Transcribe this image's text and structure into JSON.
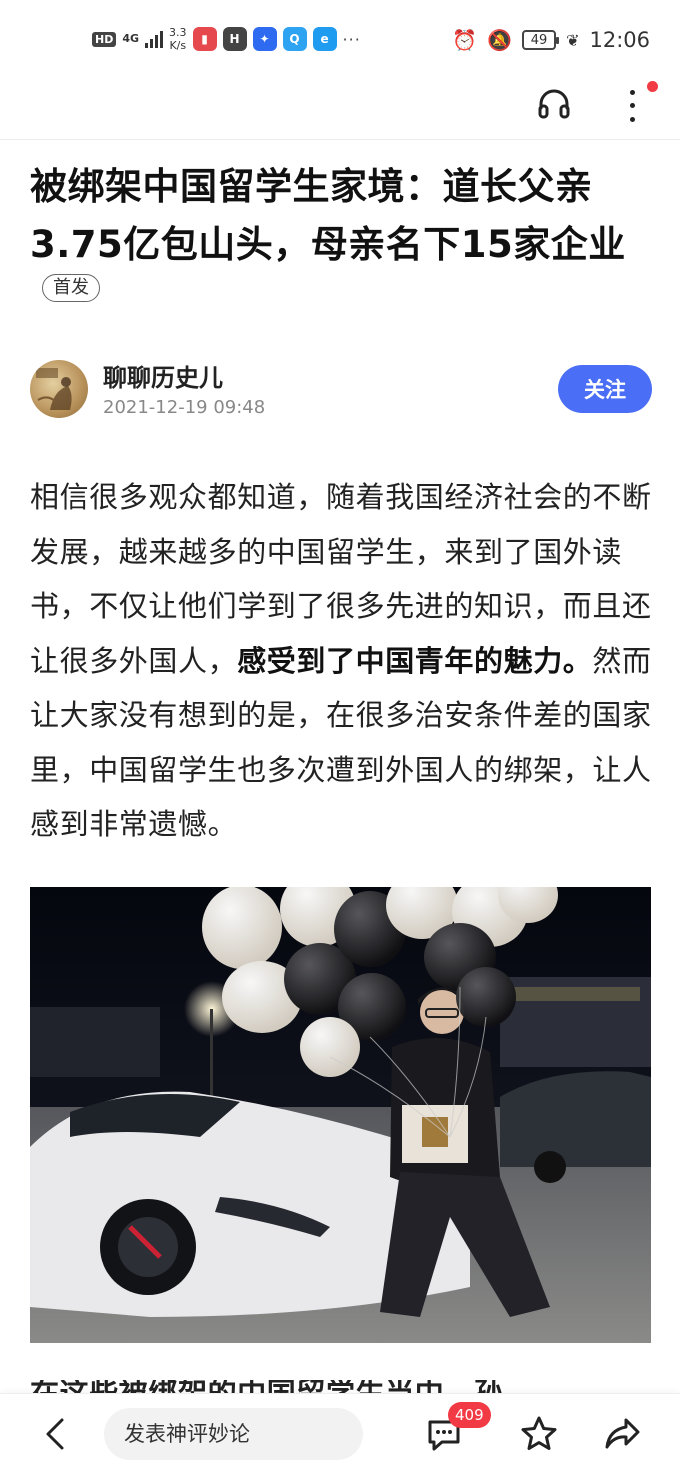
{
  "status_bar": {
    "hd": "HD",
    "network": "4G",
    "speed_value": "3.3",
    "speed_unit": "K/s",
    "apps": [
      {
        "name": "reader",
        "color": "#e5484d",
        "glyph": "▮"
      },
      {
        "name": "huawei-store",
        "color": "#444444",
        "glyph": "H"
      },
      {
        "name": "bulb",
        "color": "#2e6bf0",
        "glyph": "✦"
      },
      {
        "name": "search",
        "color": "#2ea3f2",
        "glyph": "Q"
      },
      {
        "name": "browser",
        "color": "#1f9bf0",
        "glyph": "e"
      }
    ],
    "more": "···",
    "battery": "49",
    "time": "12:06"
  },
  "article": {
    "title_line1": "被绑架中国留学生家境：道长父亲",
    "title_line2": "3.75亿包山头，母亲名下15家企业",
    "badge": "首发",
    "author": "聊聊历史儿",
    "time": "2021-12-19 09:48",
    "follow_label": "关注",
    "body_part1": "相信很多观众都知道，随着我国经济社会的不断发展，越来越多的中国留学生，来到了国外读书，不仅让他们学到了很多先进的知识，而且还让很多外国人，",
    "body_bold": "感受到了中国青年的魅力。",
    "body_part2": "然而让大家没有想到的是，在很多治安条件差的国家里，中国留学生也多次遭到外国人的绑架，让人感到非常遗憾。",
    "next_line": "在这些被绑架的中国留学生当中，孙……"
  },
  "bottom_bar": {
    "comment_placeholder": "发表神评妙论",
    "comment_count": "409"
  },
  "colors": {
    "accent": "#4a6ef5",
    "badge_red": "#f23a44"
  }
}
